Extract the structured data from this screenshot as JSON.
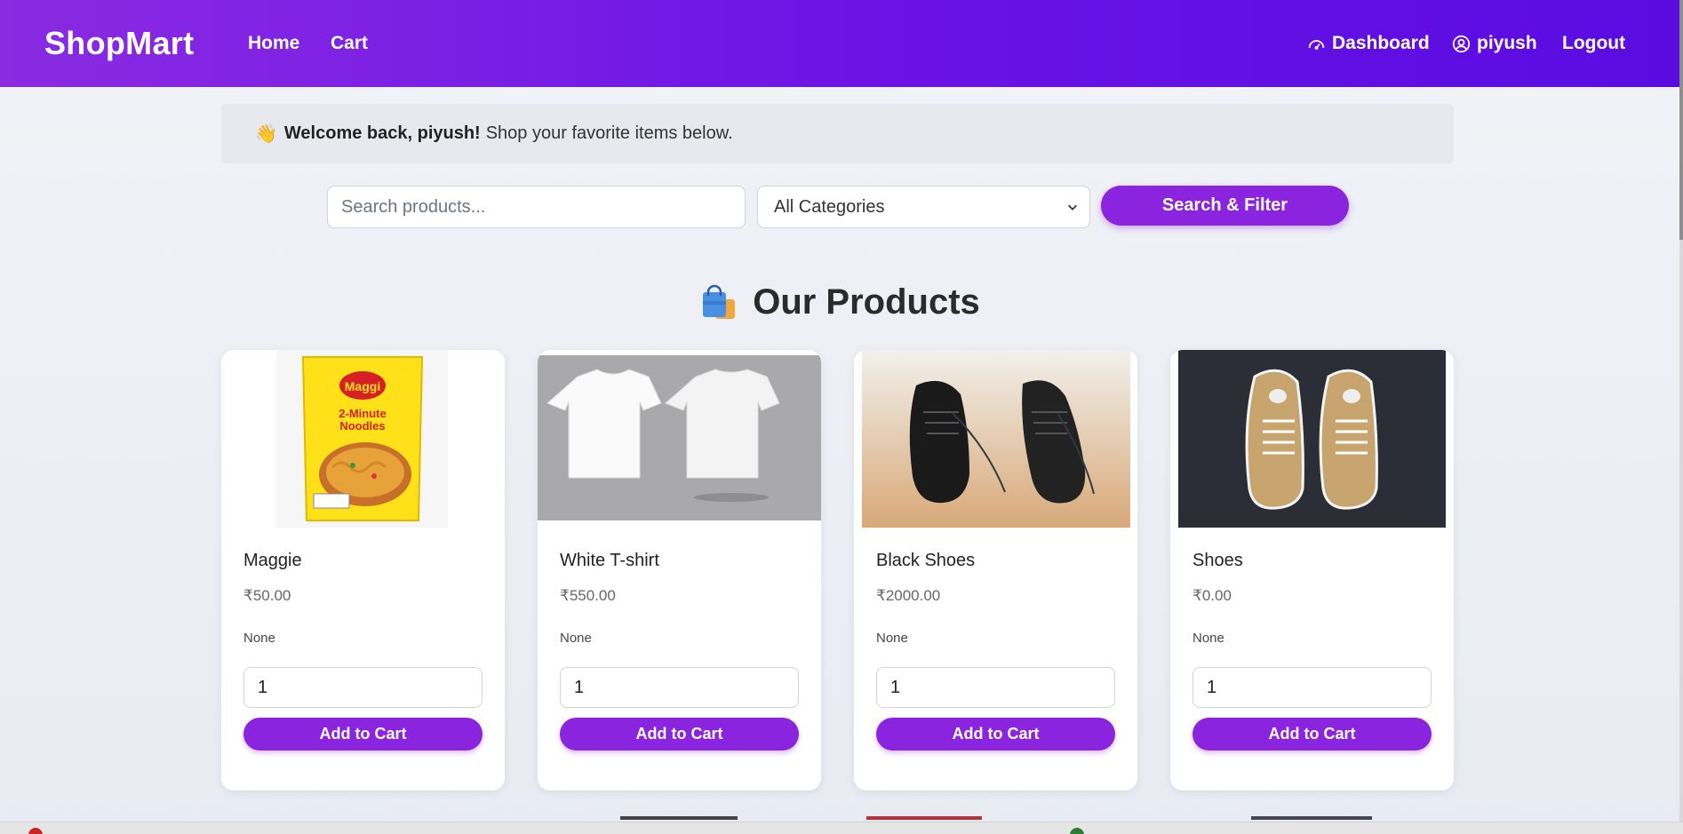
{
  "navbar": {
    "brand": "ShopMart",
    "links": {
      "home": "Home",
      "cart": "Cart",
      "dashboard": "Dashboard",
      "user": "piyush",
      "logout": "Logout"
    },
    "gradient_start": "#8a2be2",
    "gradient_end": "#5a0ce0"
  },
  "welcome": {
    "emoji": "👋",
    "bold": "Welcome back, piyush!",
    "text": "Shop your favorite items below."
  },
  "search": {
    "placeholder": "Search products...",
    "value": "",
    "category_selected": "All Categories",
    "button_label": "Search & Filter"
  },
  "products_heading": {
    "icon": "shopping-bags-icon",
    "title": "Our Products"
  },
  "products": [
    {
      "name": "Maggie",
      "price": "₹50.00",
      "description": "None",
      "quantity": "1",
      "button": "Add to Cart",
      "image": "maggi-noodles-pack"
    },
    {
      "name": "White T-shirt",
      "price": "₹550.00",
      "description": "None",
      "quantity": "1",
      "button": "Add to Cart",
      "image": "white-tshirts"
    },
    {
      "name": "Black Shoes",
      "price": "₹2000.00",
      "description": "None",
      "quantity": "1",
      "button": "Add to Cart",
      "image": "black-leather-shoes"
    },
    {
      "name": "Shoes",
      "price": "₹0.00",
      "description": "None",
      "quantity": "1",
      "button": "Add to Cart",
      "image": "tan-canvas-sneakers"
    }
  ],
  "colors": {
    "accent": "#8a24de",
    "page_bg": "#eef0f6",
    "card_bg": "#ffffff"
  }
}
